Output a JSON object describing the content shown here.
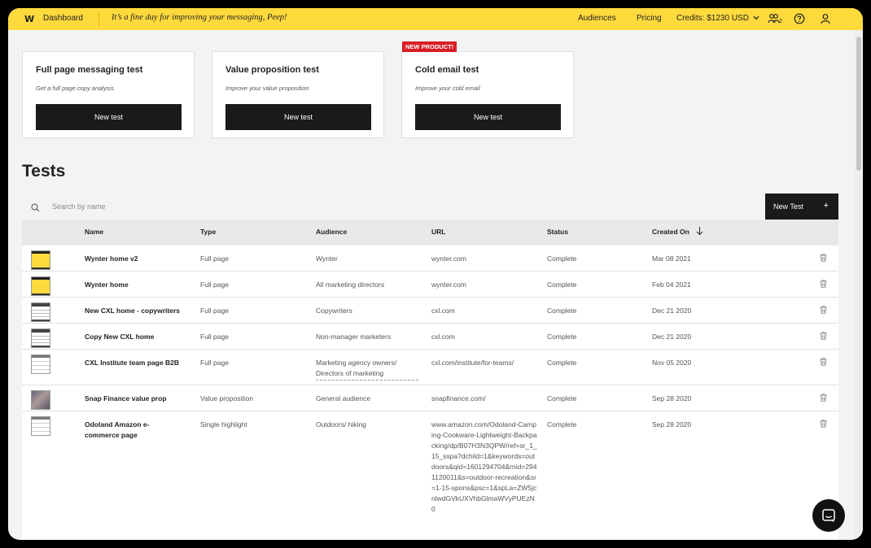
{
  "topbar": {
    "logo": "W",
    "dashboard": "Dashboard",
    "greeting": "It’s a fine day for improving your messaging, Peep!",
    "audiences": "Audiences",
    "pricing": "Pricing",
    "credits": "Credits: $1230 USD",
    "team_count": "2"
  },
  "cards": [
    {
      "title": "Full page messaging test",
      "subtitle": "Get a full page copy analysis",
      "button": "New test"
    },
    {
      "title": "Value proposition test",
      "subtitle": "Improve your value proposition",
      "button": "New test"
    },
    {
      "title": "Cold email test",
      "subtitle": "Improve your cold email",
      "button": "New test",
      "badge": "NEW PRODUCT!"
    }
  ],
  "tests": {
    "title": "Tests",
    "search_placeholder": "Search by name",
    "new_button": "New Test",
    "new_button_plus": "+",
    "columns": {
      "name": "Name",
      "type": "Type",
      "audience": "Audience",
      "url": "URL",
      "status": "Status",
      "created": "Created On"
    },
    "rows": [
      {
        "name": "Wynter home v2",
        "type": "Full page",
        "audience": "Wynter",
        "url": "wynter.com",
        "status": "Complete",
        "created": "Mar 08 2021"
      },
      {
        "name": "Wynter home",
        "type": "Full page",
        "audience": "All marketing directors",
        "url": "wynter.com",
        "status": "Complete",
        "created": "Feb 04 2021"
      },
      {
        "name": "New CXL home - copywriters",
        "type": "Full page",
        "audience": "Copywriters",
        "url": "cxl.com",
        "status": "Complete",
        "created": "Dec 21 2020"
      },
      {
        "name": "Copy New CXL home",
        "type": "Full page",
        "audience": "Non-manager marketers",
        "url": "cxl.com",
        "status": "Complete",
        "created": "Dec 21 2020"
      },
      {
        "name": "CXL Institute team page B2B",
        "type": "Full page",
        "audience": "Marketing agency owners/ Directors of marketing",
        "url": "cxl.com/institute/for-teams/",
        "status": "Complete",
        "created": "Nov 05 2020"
      },
      {
        "name": "Snap Finance value prop",
        "type": "Value proposition",
        "audience": "General audience",
        "url": "snapfinance.com/",
        "status": "Complete",
        "created": "Sep 28 2020"
      },
      {
        "name": "Odoland Amazon e-commerce page",
        "type": "Single highlight",
        "audience": "Outdoors/ hiking",
        "url": "www.amazon.com/Odoland-Camping-Cookware-Lightweight-Backpacking/dp/B07H3N3QPW/ref=sr_1_15_sspa?dchild=1&keywords=outdoors&qid=1601294704&rnid=2941120011&s=outdoor-recreation&sr=1-15-spons&psc=1&spLa=ZW5jcnlwdGVkUXVhbGlmaWVyPUEzN0",
        "status": "Complete",
        "created": "Sep 28 2020"
      }
    ]
  }
}
